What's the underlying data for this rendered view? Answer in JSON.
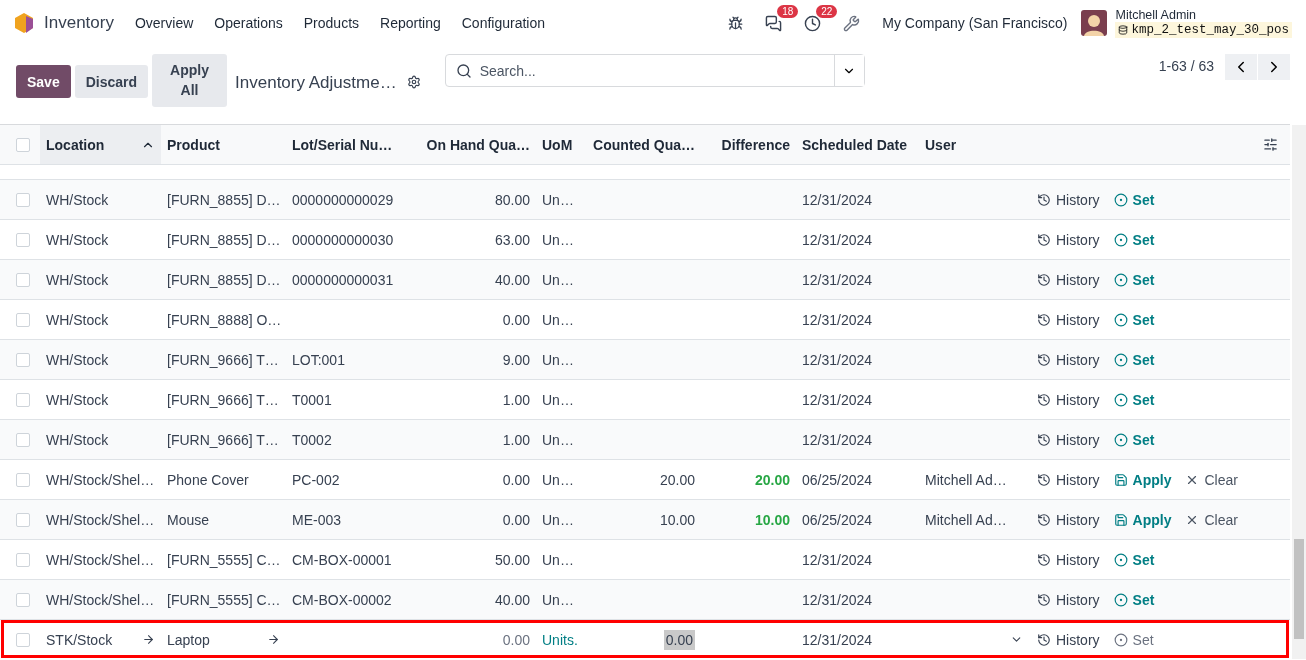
{
  "navbar": {
    "app": "Inventory",
    "menu": [
      "Overview",
      "Operations",
      "Products",
      "Reporting",
      "Configuration"
    ],
    "messages_badge": "18",
    "activities_badge": "22",
    "company": "My Company (San Francisco)",
    "user": "Mitchell Admin",
    "database": "kmp_2_test_may_30_pos"
  },
  "control_panel": {
    "buttons": [
      "Save",
      "Discard",
      "Apply All"
    ],
    "breadcrumb": "Inventory Adjustme…",
    "search": {
      "placeholder": "Search..."
    },
    "pager": "1-63 / 63"
  },
  "table": {
    "select_all_checked": false,
    "columns": [
      {
        "label": "Location",
        "sorted": true
      },
      {
        "label": "Product",
        "sorted": false
      },
      {
        "label": "Lot/Serial Nu…",
        "sorted": false
      },
      {
        "label": "On Hand Qua…",
        "sorted": false
      },
      {
        "label": "UoM",
        "sorted": false
      },
      {
        "label": "Counted Qua…",
        "sorted": false
      },
      {
        "label": "Difference",
        "sorted": false
      },
      {
        "label": "Scheduled Date",
        "sorted": false
      },
      {
        "label": "User",
        "sorted": false
      }
    ],
    "rows": [
      {
        "kind": "set",
        "checked": false,
        "location": "WH/Stock",
        "product": "[FURN_8855] D…",
        "lot": "0000000000029",
        "on_hand": "80.00",
        "uom": "Un…",
        "date": "12/31/2024",
        "actions": [
          "History",
          "Set"
        ]
      },
      {
        "kind": "set",
        "checked": false,
        "location": "WH/Stock",
        "product": "[FURN_8855] D…",
        "lot": "0000000000030",
        "on_hand": "63.00",
        "uom": "Un…",
        "date": "12/31/2024",
        "actions": [
          "History",
          "Set"
        ]
      },
      {
        "kind": "set",
        "checked": false,
        "location": "WH/Stock",
        "product": "[FURN_8855] D…",
        "lot": "0000000000031",
        "on_hand": "40.00",
        "uom": "Un…",
        "date": "12/31/2024",
        "actions": [
          "History",
          "Set"
        ]
      },
      {
        "kind": "set",
        "checked": false,
        "location": "WH/Stock",
        "product": "[FURN_8888] O…",
        "on_hand": "0.00",
        "uom": "Un…",
        "date": "12/31/2024",
        "actions": [
          "History",
          "Set"
        ]
      },
      {
        "kind": "set",
        "checked": false,
        "location": "WH/Stock",
        "product": "[FURN_9666] T…",
        "lot": "LOT:001",
        "on_hand": "9.00",
        "uom": "Un…",
        "date": "12/31/2024",
        "actions": [
          "History",
          "Set"
        ]
      },
      {
        "kind": "set",
        "checked": false,
        "location": "WH/Stock",
        "product": "[FURN_9666] T…",
        "lot": "T0001",
        "on_hand": "1.00",
        "uom": "Un…",
        "date": "12/31/2024",
        "actions": [
          "History",
          "Set"
        ]
      },
      {
        "kind": "set",
        "checked": false,
        "location": "WH/Stock",
        "product": "[FURN_9666] T…",
        "lot": "T0002",
        "on_hand": "1.00",
        "uom": "Un…",
        "date": "12/31/2024",
        "actions": [
          "History",
          "Set"
        ]
      },
      {
        "kind": "apply",
        "checked": false,
        "location": "WH/Stock/Shel…",
        "product": "Phone Cover",
        "lot": "PC-002",
        "on_hand": "0.00",
        "uom": "Un…",
        "counted": "20.00",
        "difference": "20.00",
        "date": "06/25/2024",
        "user": "Mitchell Ad…",
        "actions": [
          "History",
          "Apply",
          "Clear"
        ]
      },
      {
        "kind": "apply",
        "checked": false,
        "location": "WH/Stock/Shel…",
        "product": "Mouse",
        "lot": "ME-003",
        "on_hand": "0.00",
        "uom": "Un…",
        "counted": "10.00",
        "difference": "10.00",
        "date": "06/25/2024",
        "user": "Mitchell Ad…",
        "actions": [
          "History",
          "Apply",
          "Clear"
        ]
      },
      {
        "kind": "set",
        "checked": false,
        "location": "WH/Stock/Shel…",
        "product": "[FURN_5555] C…",
        "lot": "CM-BOX-00001",
        "on_hand": "50.00",
        "uom": "Un…",
        "date": "12/31/2024",
        "actions": [
          "History",
          "Set"
        ]
      },
      {
        "kind": "set",
        "checked": false,
        "location": "WH/Stock/Shel…",
        "product": "[FURN_5555] C…",
        "lot": "CM-BOX-00002",
        "on_hand": "40.00",
        "uom": "Un…",
        "date": "12/31/2024",
        "actions": [
          "History",
          "Set"
        ]
      },
      {
        "kind": "edit",
        "checked": false,
        "highlighted": true,
        "location": "STK/Stock",
        "product": "Laptop",
        "on_hand": "0.00",
        "uom": "Units.",
        "counted": "0.00",
        "date": "12/31/2024",
        "actions": [
          "History",
          "Set"
        ]
      }
    ]
  }
}
